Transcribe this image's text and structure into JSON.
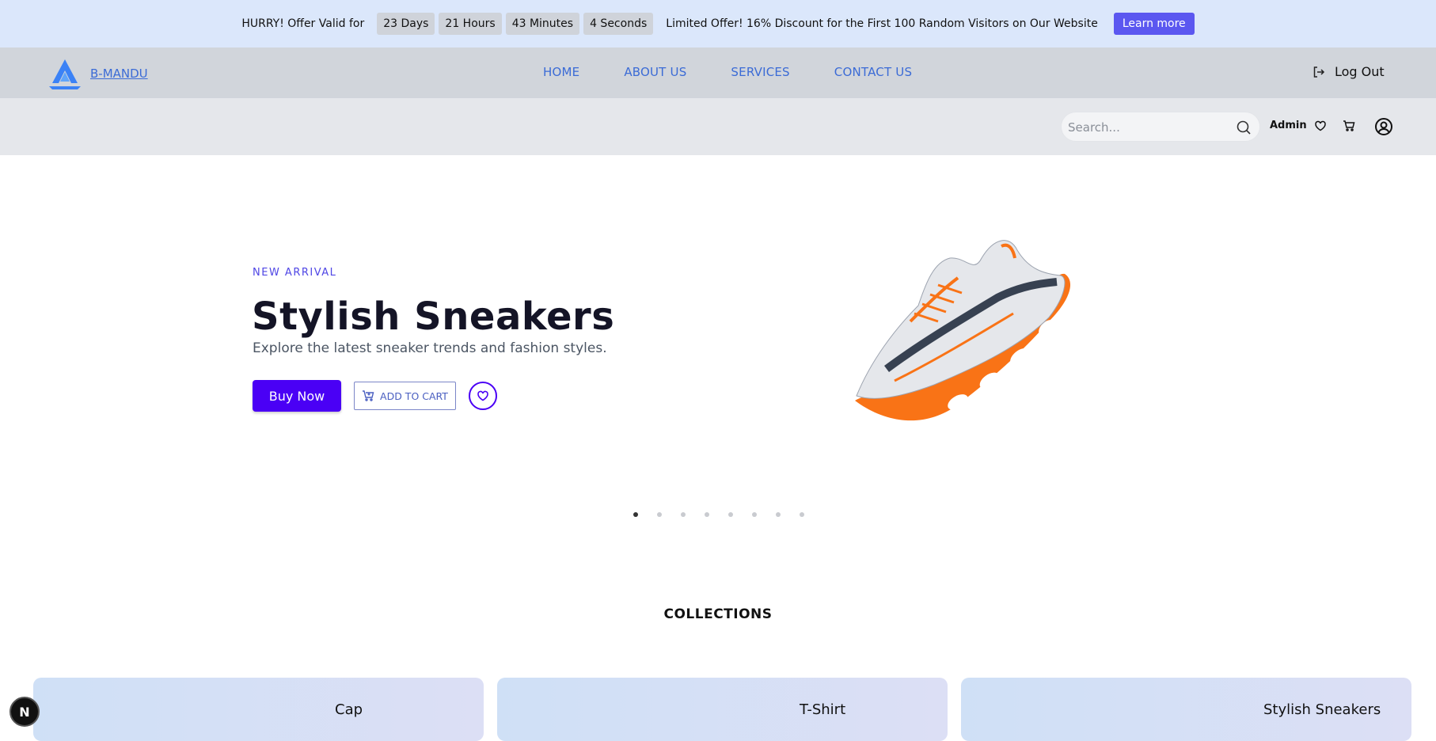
{
  "offer": {
    "lead": "HURRY! Offer Valid for",
    "countdown": [
      "23 Days",
      "21 Hours",
      "43 Minutes",
      "4 Seconds"
    ],
    "text": "Limited Offer! 16% Discount for the First 100 Random Visitors on Our Website",
    "button": "Learn more"
  },
  "nav": {
    "brand": "B-MANDU",
    "links": [
      "HOME",
      "ABOUT US",
      "SERVICES",
      "CONTACT US"
    ],
    "logout": "Log Out"
  },
  "utility": {
    "search_placeholder": "Search...",
    "user_name": "Admin"
  },
  "hero": {
    "eyebrow": "NEW ARRIVAL",
    "title": "Stylish Sneakers",
    "subtitle": "Explore the latest sneaker trends and fashion styles.",
    "buy_label": "Buy Now",
    "cart_label": "ADD TO CART",
    "slide_count": 8,
    "active_slide": 1
  },
  "collections": {
    "title": "COLLECTIONS",
    "items": [
      "Cap",
      "T-Shirt",
      "Stylish Sneakers"
    ]
  },
  "badge": {
    "letter": "N"
  },
  "colors": {
    "accent": "#4a00f5",
    "link": "#3b6bd6",
    "banner_bg": "#dbe7fb"
  }
}
